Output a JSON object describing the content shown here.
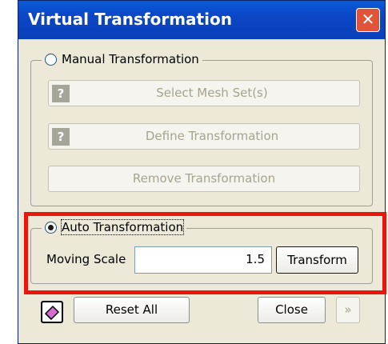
{
  "window": {
    "title": "Virtual Transformation",
    "close_icon": "close-x-icon"
  },
  "manual": {
    "label": "Manual Transformation",
    "selected": false,
    "select_mesh_label": "Select Mesh Set(s)",
    "define_label": "Define Transformation",
    "remove_label": "Remove Transformation",
    "help_icon_glyph": "?"
  },
  "auto": {
    "label": "Auto Transformation",
    "selected": true,
    "moving_scale_label": "Moving Scale",
    "moving_scale_value": "1.5",
    "transform_label": "Transform"
  },
  "footer": {
    "reset_label": "Reset All",
    "close_label": "Close",
    "more_glyph": "»"
  },
  "colors": {
    "titlebar": "#0b46c6",
    "highlight": "#e8170c",
    "dialog_bg": "#ece9d8"
  }
}
